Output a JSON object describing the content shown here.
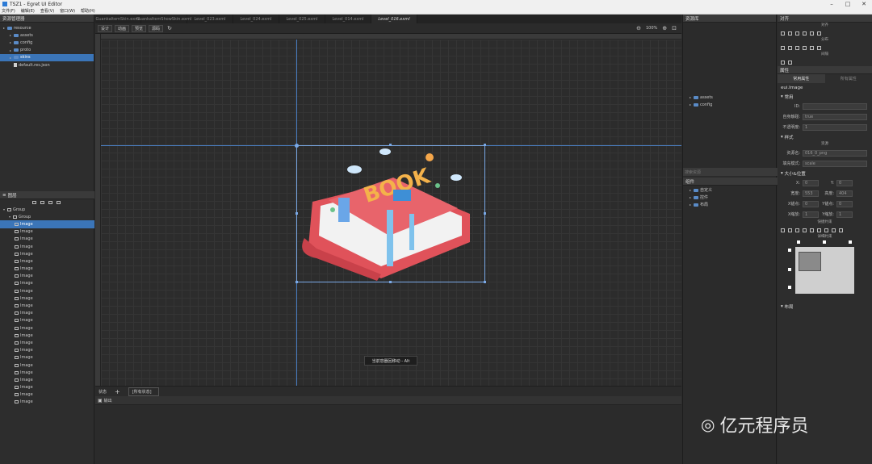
{
  "app": {
    "title": "TSZ1 - Egret UI Editor"
  },
  "menu": [
    "文件(F)",
    "编辑(E)",
    "查看(V)",
    "窗口(W)",
    "帮助(H)"
  ],
  "left": {
    "resource_header": "资源管理器",
    "resource_tree": [
      {
        "label": "resource",
        "depth": 0,
        "type": "folder"
      },
      {
        "label": "assets",
        "depth": 1,
        "type": "folder"
      },
      {
        "label": "config",
        "depth": 1,
        "type": "folder"
      },
      {
        "label": "proto",
        "depth": 1,
        "type": "folder"
      },
      {
        "label": "skins",
        "depth": 1,
        "type": "folder",
        "selected": true
      },
      {
        "label": "default.res.json",
        "depth": 1,
        "type": "file"
      }
    ],
    "layer_header": "图层",
    "layer_tree": [
      {
        "label": "Group",
        "depth": 0
      },
      {
        "label": "Group",
        "depth": 1
      },
      {
        "label": "Image",
        "depth": 2,
        "selected": true
      },
      {
        "label": "Image",
        "depth": 2
      },
      {
        "label": "Image",
        "depth": 2
      },
      {
        "label": "Image",
        "depth": 2
      },
      {
        "label": "Image",
        "depth": 2
      },
      {
        "label": "Image",
        "depth": 2
      },
      {
        "label": "Image",
        "depth": 2
      },
      {
        "label": "Image",
        "depth": 2
      },
      {
        "label": "Image",
        "depth": 2
      },
      {
        "label": "Image",
        "depth": 2
      },
      {
        "label": "Image",
        "depth": 2
      },
      {
        "label": "Image",
        "depth": 2
      },
      {
        "label": "Image",
        "depth": 2
      },
      {
        "label": "Image",
        "depth": 2
      },
      {
        "label": "Image",
        "depth": 2
      },
      {
        "label": "Image",
        "depth": 2
      },
      {
        "label": "Image",
        "depth": 2
      },
      {
        "label": "Image",
        "depth": 2
      },
      {
        "label": "Image",
        "depth": 2
      },
      {
        "label": "Image",
        "depth": 2
      },
      {
        "label": "Image",
        "depth": 2
      },
      {
        "label": "Image",
        "depth": 2
      },
      {
        "label": "Image",
        "depth": 2
      },
      {
        "label": "Image",
        "depth": 2
      },
      {
        "label": "Image",
        "depth": 2
      }
    ]
  },
  "tabs": [
    {
      "label": "GuankaItemSkin.exml",
      "active": false
    },
    {
      "label": "GuankaItemShowSkin.exml",
      "active": false
    },
    {
      "label": "Level_023.exml",
      "active": false
    },
    {
      "label": "Level_024.exml",
      "active": false
    },
    {
      "label": "Level_025.exml",
      "active": false
    },
    {
      "label": "Level_014.exml",
      "active": false
    },
    {
      "label": "Level_016.exml",
      "active": true
    }
  ],
  "toolbar": {
    "design": "设计",
    "animation": "动画",
    "preview": "预览",
    "source": "源码",
    "zoom": "100%"
  },
  "canvas": {
    "tooltip": "当前容器回移动 - Alt",
    "book_text": "BOOK"
  },
  "statebar": {
    "label": "状态",
    "add": "+",
    "state_value": "[所有状态]"
  },
  "output": {
    "label": "输出"
  },
  "resources": {
    "header": "资源库",
    "tree": [
      {
        "label": "assets"
      },
      {
        "label": "config"
      }
    ],
    "search_placeholder": "搜索资源",
    "components_header": "组件",
    "components": [
      {
        "label": "自定义"
      },
      {
        "label": "控件"
      },
      {
        "label": "布局"
      }
    ]
  },
  "props": {
    "align_header": "对齐",
    "align_sub": "对齐",
    "distribute_sub": "分布",
    "spacing_sub": "间隔",
    "attr_header": "属性",
    "tab_common": "常用属性",
    "tab_all": "所有属性",
    "component_name": "eui.Image",
    "common_section": "常用",
    "id_label": "ID:",
    "id_value": "",
    "touch_label": "自身触碰:",
    "touch_value": "true",
    "alpha_label": "不透明度:",
    "alpha_value": "1",
    "style_section": "样式",
    "resource_sub": "资源",
    "source_label": "资源名:",
    "source_value": "016_0_png",
    "fill_label": "填充模式:",
    "fill_value": "scale",
    "size_section": "大小&位置",
    "x_label": "X:",
    "x_value": "0",
    "y_label": "Y:",
    "y_value": "0",
    "w_label": "宽度:",
    "w_value": "553",
    "h_label": "高度:",
    "h_value": "404",
    "ax_label": "X锚点:",
    "ax_value": "0",
    "ay_label": "Y锚点:",
    "ay_value": "0",
    "sx_label": "X缩放:",
    "sx_value": "1",
    "sy_label": "Y缩放:",
    "sy_value": "1",
    "quick_sub": "快捷约束",
    "detail_sub": "详细约束",
    "layout_section": "布局"
  },
  "watermark": {
    "text": "亿元程序员"
  },
  "colors": {
    "accent": "#3b75b8",
    "selection": "#5a8fd8",
    "book_red": "#e0525a"
  }
}
